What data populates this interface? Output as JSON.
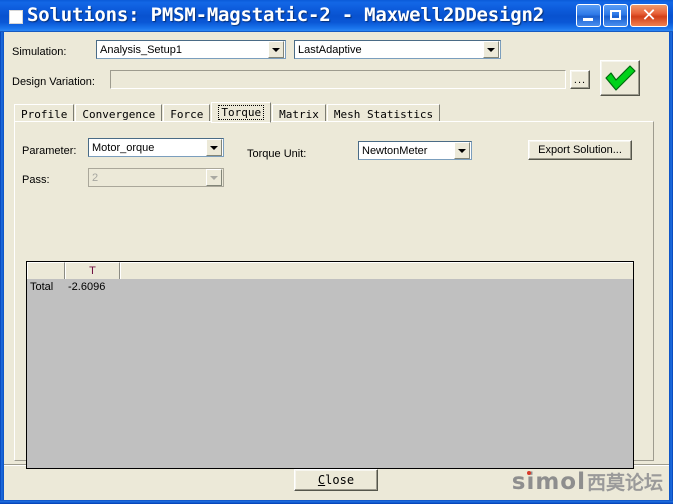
{
  "window": {
    "title": "Solutions: PMSM-Magstatic-2 - Maxwell2DDesign2",
    "icon": "document-icon",
    "buttons": {
      "minimize": "minimize-icon",
      "maximize": "maximize-icon",
      "close": "✕"
    }
  },
  "top": {
    "simulation_label": "Simulation:",
    "simulation_value": "Analysis_Setup1",
    "solution_value": "LastAdaptive",
    "design_variation_label": "Design Variation:",
    "design_variation_value": "",
    "browse_label": "...",
    "validate_icon": "green-checkmark-icon"
  },
  "tabs": [
    {
      "label": "Profile",
      "active": false
    },
    {
      "label": "Convergence",
      "active": false
    },
    {
      "label": "Force",
      "active": false
    },
    {
      "label": "Torque",
      "active": true
    },
    {
      "label": "Matrix",
      "active": false
    },
    {
      "label": "Mesh Statistics",
      "active": false
    }
  ],
  "torque_panel": {
    "parameter_label": "Parameter:",
    "parameter_value": "Motor_orque",
    "torque_unit_label": "Torque Unit:",
    "torque_unit_value": "NewtonMeter",
    "export_label": "Export Solution...",
    "pass_label": "Pass:",
    "pass_value": "2"
  },
  "grid": {
    "headers": [
      "",
      "T",
      ""
    ],
    "rows": [
      [
        "Total",
        "-2.6096",
        ""
      ]
    ]
  },
  "footer": {
    "close_accel": "C",
    "close_rest": "lose",
    "watermark_text": "simol",
    "watermark_cn": "西莫论坛"
  },
  "colors": {
    "dialog_bg": "#ece9d8",
    "titlebar_blue": "#0a52cf",
    "grid_bg": "#c0c0c0",
    "grid_header_text": "#701040",
    "accent_green": "#00d21a",
    "watermark_gray": "#8e8e8e",
    "watermark_dot_red": "#d83a2a"
  }
}
